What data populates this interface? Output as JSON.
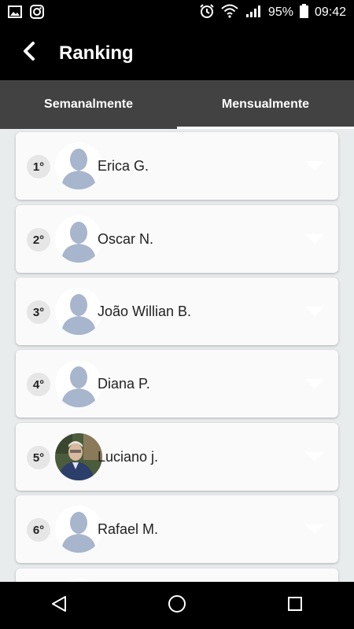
{
  "status_bar": {
    "battery": "95%",
    "time": "09:42",
    "left_icons": [
      "image-icon",
      "instagram-icon"
    ],
    "right_icons": [
      "alarm-icon",
      "wifi-icon",
      "signal-icon",
      "battery-icon"
    ]
  },
  "app_bar": {
    "title": "Ranking",
    "back_icon": "chevron-left-icon"
  },
  "tabs": [
    {
      "label": "Semanalmente",
      "active": false
    },
    {
      "label": "Mensualmente",
      "active": true
    }
  ],
  "ranking": [
    {
      "rank": "1°",
      "name": "Erica G.",
      "photo": "placeholder"
    },
    {
      "rank": "2°",
      "name": "Oscar N.",
      "photo": "placeholder"
    },
    {
      "rank": "3°",
      "name": "João Willian B.",
      "photo": "placeholder"
    },
    {
      "rank": "4°",
      "name": "Diana P.",
      "photo": "placeholder"
    },
    {
      "rank": "5°",
      "name": "Luciano j.",
      "photo": "user-photo"
    },
    {
      "rank": "6°",
      "name": "Rafael M.",
      "photo": "placeholder"
    },
    {
      "rank": "",
      "name": "",
      "photo": "placeholder"
    }
  ],
  "nav_bar": [
    "back-triangle-icon",
    "home-circle-icon",
    "recents-square-icon"
  ],
  "colors": {
    "background": "#e9eced",
    "tab_bar": "#424242",
    "placeholder_avatar": "#a7b5cd"
  }
}
